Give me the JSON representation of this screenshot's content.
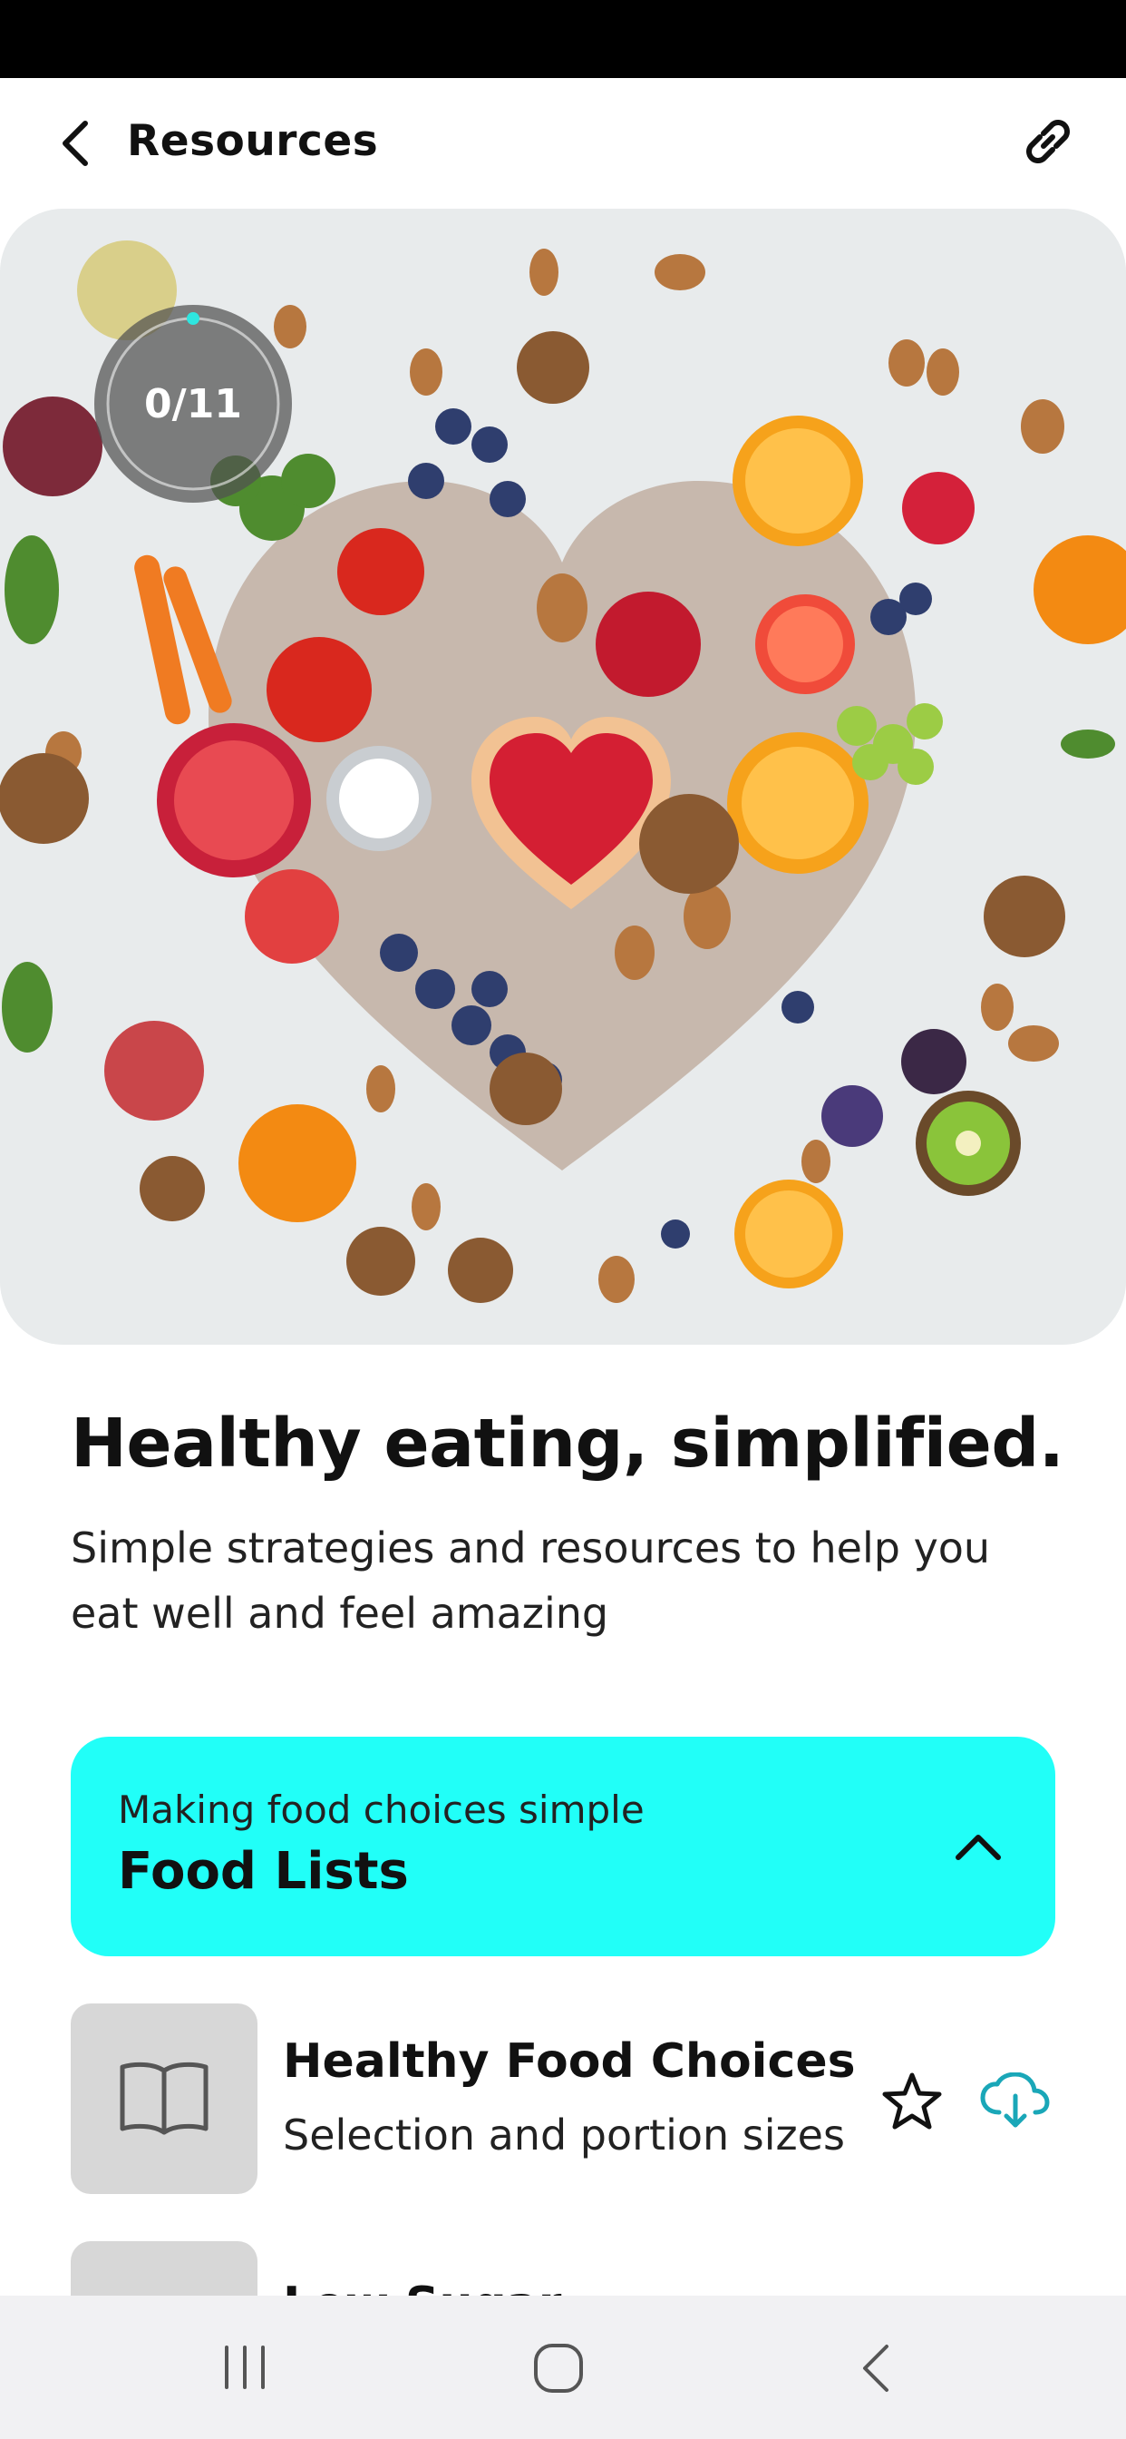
{
  "header": {
    "title": "Resources",
    "back_icon": "chevron-left-icon",
    "share_icon": "link-icon"
  },
  "hero": {
    "image_description": "Heart shape made of fruits, vegetables, nuts and berries",
    "progress_text": "0/11",
    "progress_fraction": 0
  },
  "intro": {
    "headline": "Healthy eating, simplified.",
    "subtitle": "Simple strategies and resources to help you eat well and feel amazing"
  },
  "section": {
    "subtitle": "Making food choices simple",
    "title": "Food Lists",
    "expanded": true,
    "accent_color": "#21fff8"
  },
  "items": [
    {
      "title": "Healthy Food Choices",
      "subtitle": "Selection and portion sizes",
      "icon": "book-icon",
      "favorite": false,
      "download_color": "#1aa7b8"
    },
    {
      "title": "Low Sugar",
      "subtitle": ""
    }
  ],
  "nav": {
    "recents_icon": "recents-icon",
    "home_icon": "home-icon",
    "back_icon": "back-icon"
  }
}
